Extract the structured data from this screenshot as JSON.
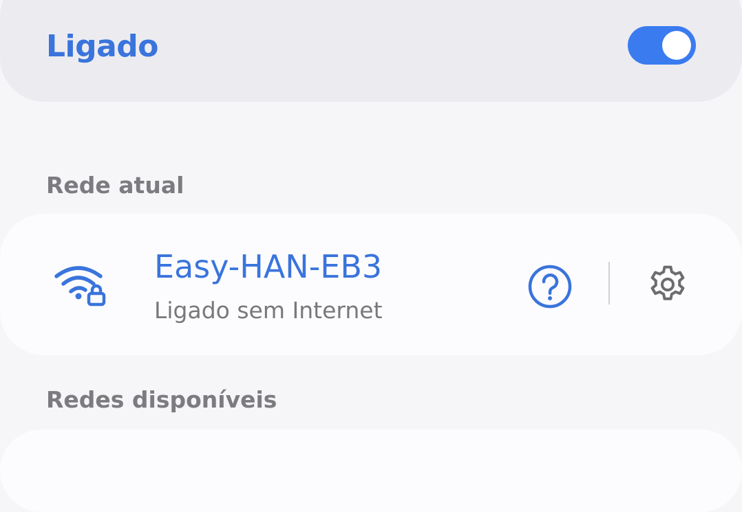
{
  "wifi_toggle": {
    "title": "Ligado",
    "enabled": true,
    "accent_color": "#3a7bf0"
  },
  "current_network_section": {
    "header": "Rede atual",
    "network": {
      "name": "Easy-HAN-EB3",
      "status": "Ligado sem Internet",
      "icon": "wifi-locked-icon",
      "help_icon": "help-icon",
      "settings_icon": "gear-icon"
    }
  },
  "available_networks_section": {
    "header": "Redes disponíveis"
  }
}
